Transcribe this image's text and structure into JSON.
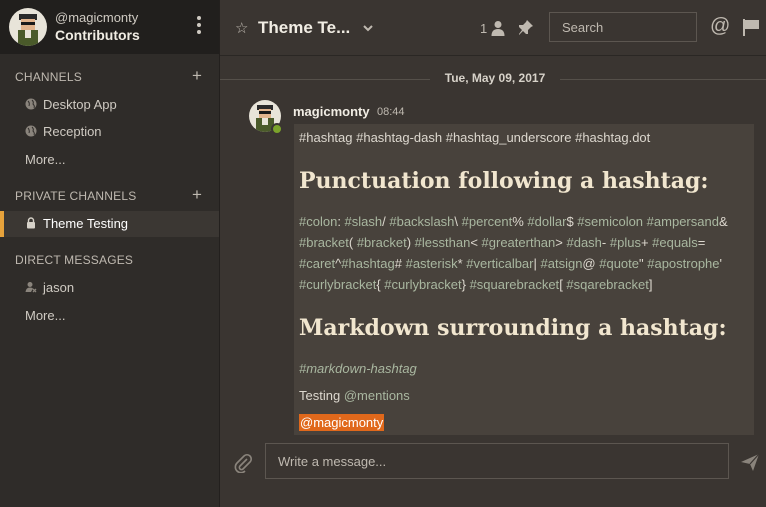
{
  "team": {
    "username": "@magicmonty",
    "name": "Contributors"
  },
  "sidebar": {
    "channels_title": "CHANNELS",
    "channels": [
      {
        "label": "Desktop App"
      },
      {
        "label": "Reception"
      }
    ],
    "channels_more": "More...",
    "private_title": "PRIVATE CHANNELS",
    "private": [
      {
        "label": "Theme Testing"
      }
    ],
    "dm_title": "DIRECT MESSAGES",
    "dms": [
      {
        "label": "jason"
      }
    ],
    "dm_more": "More..."
  },
  "header": {
    "channel_title": "Theme Te...",
    "member_count": "1",
    "search_placeholder": "Search"
  },
  "date_separator": "Tue, May 09, 2017",
  "post": {
    "username": "magicmonty",
    "time": "08:44",
    "line1": "#hashtag #hashtag-dash #hashtag_underscore #hashtag.dot",
    "heading1": "Punctuation following a hashtag:",
    "punct_lines": [
      [
        {
          "t": "#colon",
          "tag": true
        },
        {
          "t": ": "
        },
        {
          "t": "#slash",
          "tag": true
        },
        {
          "t": "/ "
        },
        {
          "t": "#backslash",
          "tag": true
        },
        {
          "t": "\\ "
        },
        {
          "t": "#percent",
          "tag": true
        },
        {
          "t": "% "
        },
        {
          "t": "#dollar",
          "tag": true
        },
        {
          "t": "$ "
        },
        {
          "t": "#semicolon",
          "tag": true
        },
        {
          "t": " "
        },
        {
          "t": "#ampersand",
          "tag": true
        },
        {
          "t": "&"
        }
      ],
      [
        {
          "t": "#bracket",
          "tag": true
        },
        {
          "t": "( "
        },
        {
          "t": "#bracket",
          "tag": true
        },
        {
          "t": ") "
        },
        {
          "t": "#lessthan",
          "tag": true
        },
        {
          "t": "< "
        },
        {
          "t": "#greaterthan",
          "tag": true
        },
        {
          "t": "> "
        },
        {
          "t": "#dash",
          "tag": true
        },
        {
          "t": "- "
        },
        {
          "t": "#plus",
          "tag": true
        },
        {
          "t": "+ "
        },
        {
          "t": "#equals",
          "tag": true
        },
        {
          "t": "="
        }
      ],
      [
        {
          "t": "#caret",
          "tag": true
        },
        {
          "t": "^"
        },
        {
          "t": "#hashtag",
          "tag": true
        },
        {
          "t": "# "
        },
        {
          "t": "#asterisk",
          "tag": true
        },
        {
          "t": "* "
        },
        {
          "t": "#verticalbar",
          "tag": true
        },
        {
          "t": "| "
        },
        {
          "t": "#atsign",
          "tag": true
        },
        {
          "t": "@ "
        },
        {
          "t": "#quote",
          "tag": true
        },
        {
          "t": "\" "
        },
        {
          "t": "#apostrophe",
          "tag": true
        },
        {
          "t": "'"
        }
      ],
      [
        {
          "t": "#curlybracket",
          "tag": true
        },
        {
          "t": "{ "
        },
        {
          "t": "#curlybracket",
          "tag": true
        },
        {
          "t": "} "
        },
        {
          "t": "#squarebracket",
          "tag": true
        },
        {
          "t": "[ "
        },
        {
          "t": "#sqarebracket",
          "tag": true
        },
        {
          "t": "]"
        }
      ]
    ],
    "heading2": "Markdown surrounding a hashtag:",
    "md_hashtag": "#markdown-hashtag",
    "testing_text": "Testing",
    "testing_mention": "@mentions",
    "self_mention": "@magicmonty"
  },
  "composer": {
    "placeholder": "Write a message..."
  },
  "colors": {
    "accent": "#e6a23b",
    "mention_highlight": "#e0681b",
    "online": "#7ba32b",
    "hashtag": "#a9b7a0"
  }
}
